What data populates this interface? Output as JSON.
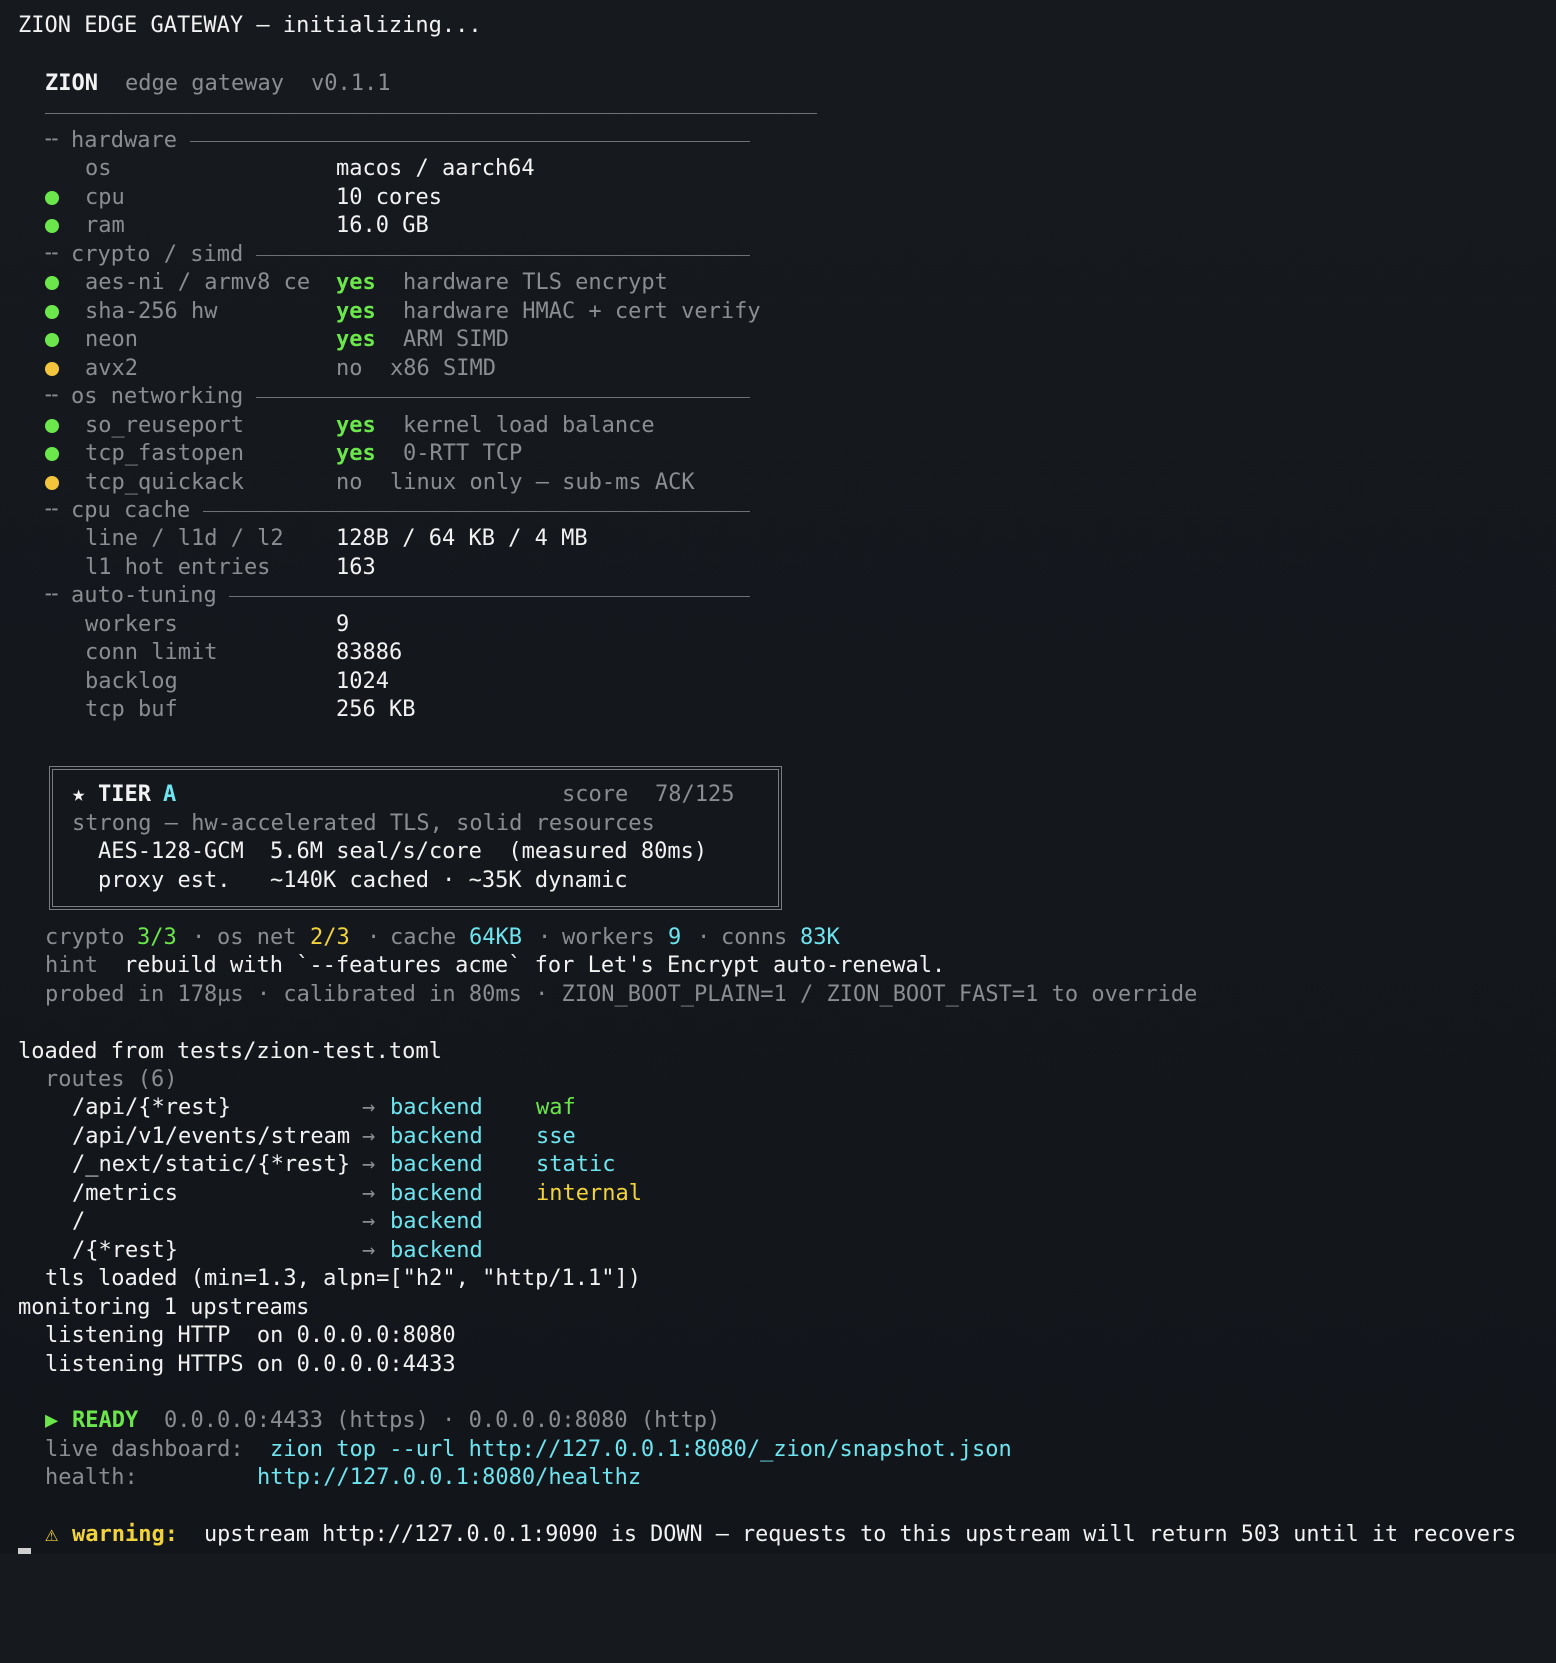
{
  "title_line": "ZION EDGE GATEWAY — initializing...",
  "banner": {
    "name": "ZION",
    "subtitle": "edge gateway",
    "version": "v0.1.1"
  },
  "sections": {
    "hardware": "hardware",
    "crypto": "crypto / simd",
    "net": "os networking",
    "cache": "cpu cache",
    "tuning": "auto-tuning"
  },
  "hardware": [
    {
      "label": "os",
      "value": "macos / aarch64"
    },
    {
      "label": "cpu",
      "value": "10 cores"
    },
    {
      "label": "ram",
      "value": "16.0 GB"
    }
  ],
  "crypto": [
    {
      "label": "aes-ni / armv8 ce",
      "value": "yes",
      "desc": "hardware TLS encrypt"
    },
    {
      "label": "sha-256 hw",
      "value": "yes",
      "desc": "hardware HMAC + cert verify"
    },
    {
      "label": "neon",
      "value": "yes",
      "desc": "ARM SIMD"
    },
    {
      "label": "avx2",
      "value": "no",
      "desc": "x86 SIMD"
    }
  ],
  "net": [
    {
      "label": "so_reuseport",
      "value": "yes",
      "desc": "kernel load balance"
    },
    {
      "label": "tcp_fastopen",
      "value": "yes",
      "desc": "0-RTT TCP"
    },
    {
      "label": "tcp_quickack",
      "value": "no",
      "desc": "linux only — sub-ms ACK"
    }
  ],
  "cache": [
    {
      "label": "line / l1d / l2",
      "value": "128B / 64 KB / 4 MB"
    },
    {
      "label": "l1 hot entries",
      "value": "163"
    }
  ],
  "tuning": [
    {
      "label": "workers",
      "value": "9"
    },
    {
      "label": "conn limit",
      "value": "83886"
    },
    {
      "label": "backlog",
      "value": "1024"
    },
    {
      "label": "tcp buf",
      "value": "256 KB"
    }
  ],
  "tier": {
    "star": "★",
    "label": "TIER",
    "grade": "A",
    "score_label": "score",
    "score": "78/125",
    "summary": "strong — hw-accelerated TLS, solid resources",
    "aes_label": "AES-128-GCM",
    "aes_value": "5.6M seal/s/core  (measured 80ms)",
    "proxy_label": "proxy est.",
    "proxy_value": "~140K cached · ~35K dynamic"
  },
  "stats": {
    "crypto_label": "crypto",
    "crypto_value": "3/3",
    "net_label": "os net",
    "net_value": "2/3",
    "cache_label": "cache",
    "cache_value": "64KB",
    "workers_label": "workers",
    "workers_value": "9",
    "conns_label": "conns",
    "conns_value": "83K",
    "sep": "·"
  },
  "hint": {
    "label": "hint",
    "text": "rebuild with `--features acme` for Let's Encrypt auto-renewal."
  },
  "probed": "probed in 178µs · calibrated in 80ms · ZION_BOOT_PLAIN=1 / ZION_BOOT_FAST=1 to override",
  "loaded": "loaded from tests/zion-test.toml",
  "routes_header": "routes (6)",
  "routes": [
    {
      "path": "/api/{*rest}",
      "arrow": "→",
      "target": "backend",
      "tag": "waf"
    },
    {
      "path": "/api/v1/events/stream",
      "arrow": "→",
      "target": "backend",
      "tag": "sse"
    },
    {
      "path": "/_next/static/{*rest}",
      "arrow": "→",
      "target": "backend",
      "tag": "static"
    },
    {
      "path": "/metrics",
      "arrow": "→",
      "target": "backend",
      "tag": "internal"
    },
    {
      "path": "/",
      "arrow": "→",
      "target": "backend",
      "tag": ""
    },
    {
      "path": "/{*rest}",
      "arrow": "→",
      "target": "backend",
      "tag": ""
    }
  ],
  "tls": "tls loaded (min=1.3, alpn=[\"h2\", \"http/1.1\"])",
  "monitoring": "monitoring 1 upstreams",
  "listen_http": "listening HTTP  on 0.0.0.0:8080",
  "listen_https": "listening HTTPS on 0.0.0.0:4433",
  "ready": {
    "icon": "▶",
    "label": "READY",
    "addrs": "0.0.0.0:4433 (https) · 0.0.0.0:8080 (http)",
    "dash_label": "live dashboard:",
    "dash_cmd": "zion top --url http://127.0.0.1:8080/_zion/snapshot.json",
    "health_label": "health:",
    "health_url": "http://127.0.0.1:8080/healthz"
  },
  "warning": {
    "icon": "⚠",
    "label": "warning:",
    "text": "upstream http://127.0.0.1:9090 is DOWN — requests to this upstream will return 503 until it recovers"
  },
  "colors": {
    "background": "#161a1f",
    "green": "#6be64b",
    "yellow": "#f2d33c",
    "cyan": "#6ee4ef",
    "dim": "#8a8e93"
  }
}
